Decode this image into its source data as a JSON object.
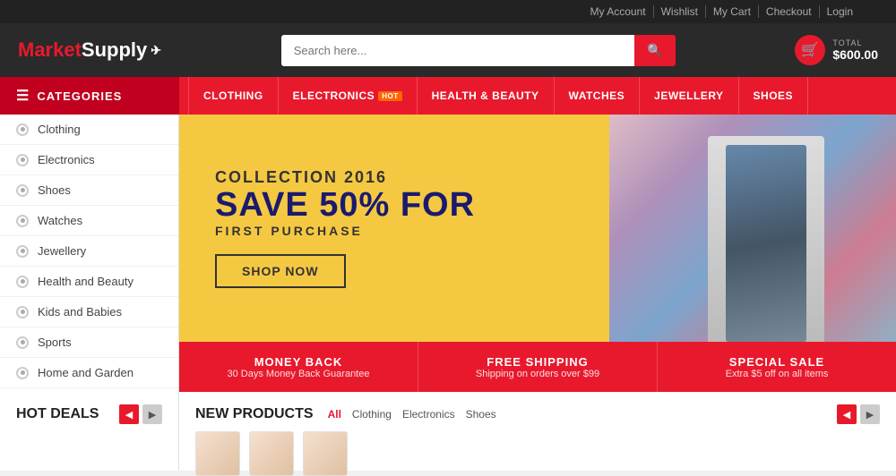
{
  "topbar": {
    "links": [
      "My Account",
      "Wishlist",
      "My Cart",
      "Checkout",
      "Login"
    ]
  },
  "header": {
    "logo_market": "Market",
    "logo_supply": "Supply",
    "search_placeholder": "Search here...",
    "cart_label": "TOTAL",
    "cart_amount": "$600.00"
  },
  "nav": {
    "categories_label": "CATEGORIES",
    "links": [
      {
        "label": "CLOTHING",
        "hot": false
      },
      {
        "label": "ELECTRONICS",
        "hot": true
      },
      {
        "label": "HEALTH & BEAUTY",
        "hot": false
      },
      {
        "label": "WATCHES",
        "hot": false
      },
      {
        "label": "JEWELLERY",
        "hot": false
      },
      {
        "label": "SHOES",
        "hot": false
      }
    ]
  },
  "sidebar": {
    "items": [
      "Clothing",
      "Electronics",
      "Shoes",
      "Watches",
      "Jewellery",
      "Health and Beauty",
      "Kids and Babies",
      "Sports",
      "Home and Garden"
    ]
  },
  "hero": {
    "subtitle": "COLLECTION 2016",
    "title_line1": "SAVE 50% FOR",
    "desc": "FIRST PURCHASE",
    "shop_btn": "SHOP NOW"
  },
  "promo": {
    "items": [
      {
        "title": "MONEY BACK",
        "desc": "30 Days Money Back Guarantee"
      },
      {
        "title": "FREE SHIPPING",
        "desc": "Shipping on orders over $99"
      },
      {
        "title": "SPECIAL SALE",
        "desc": "Extra $5 off on all items"
      }
    ]
  },
  "hot_deals": {
    "title": "HOT DEALS",
    "prev_label": "◀",
    "next_label": "▶"
  },
  "new_products": {
    "title": "NEW PRODUCTS",
    "filters": [
      "All",
      "Clothing",
      "Electronics",
      "Shoes"
    ],
    "active_filter": "All",
    "prev_label": "◀",
    "next_label": "▶"
  }
}
